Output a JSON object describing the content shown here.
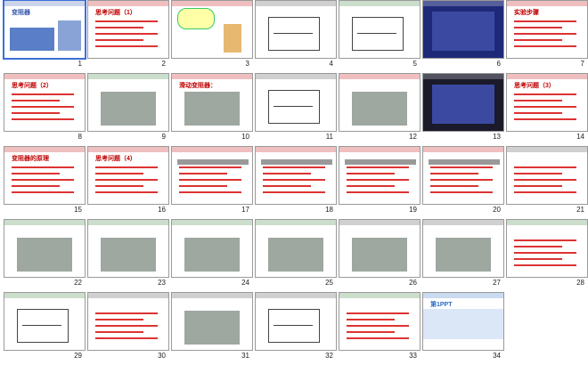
{
  "slides": [
    {
      "num": "1",
      "title": "变阻器",
      "bg": "#ffffff",
      "accent": "#3355aa",
      "kind": "cover"
    },
    {
      "num": "2",
      "title": "思考问题（1）",
      "bg": "#ffffff",
      "accent": "#c00000",
      "kind": "question"
    },
    {
      "num": "3",
      "title": "",
      "bg": "#ffffff",
      "accent": "#c00000",
      "kind": "cartoon"
    },
    {
      "num": "4",
      "title": "",
      "bg": "#ffffff",
      "accent": "#444444",
      "kind": "diagram"
    },
    {
      "num": "5",
      "title": "",
      "bg": "#ffffff",
      "accent": "#2e7d32",
      "kind": "circuit"
    },
    {
      "num": "6",
      "title": "",
      "bg": "#1e2a78",
      "accent": "#ffffff",
      "kind": "photo-dark"
    },
    {
      "num": "7",
      "title": "实验步骤",
      "bg": "#ffffff",
      "accent": "#c00000",
      "kind": "text"
    },
    {
      "num": "8",
      "title": "思考问题（2）",
      "bg": "#ffffff",
      "accent": "#c00000",
      "kind": "question"
    },
    {
      "num": "9",
      "title": "",
      "bg": "#ffffff",
      "accent": "#2e7d32",
      "kind": "photo"
    },
    {
      "num": "10",
      "title": "滑动变阻器：",
      "bg": "#ffffff",
      "accent": "#c00000",
      "kind": "photo"
    },
    {
      "num": "11",
      "title": "",
      "bg": "#ffffff",
      "accent": "#444444",
      "kind": "diagram"
    },
    {
      "num": "12",
      "title": "",
      "bg": "#ffffff",
      "accent": "#c00000",
      "kind": "photo"
    },
    {
      "num": "13",
      "title": "",
      "bg": "#1a1a2a",
      "accent": "#ffffff",
      "kind": "photo-dark"
    },
    {
      "num": "14",
      "title": "思考问题（3）",
      "bg": "#ffffff",
      "accent": "#c00000",
      "kind": "question"
    },
    {
      "num": "15",
      "title": "变阻器的原理",
      "bg": "#ffffff",
      "accent": "#c00000",
      "kind": "text"
    },
    {
      "num": "16",
      "title": "思考问题（4）",
      "bg": "#ffffff",
      "accent": "#c00000",
      "kind": "question"
    },
    {
      "num": "17",
      "title": "",
      "bg": "#ffffff",
      "accent": "#c00000",
      "kind": "quiz"
    },
    {
      "num": "18",
      "title": "",
      "bg": "#ffffff",
      "accent": "#c00000",
      "kind": "quiz"
    },
    {
      "num": "19",
      "title": "",
      "bg": "#ffffff",
      "accent": "#c00000",
      "kind": "quiz"
    },
    {
      "num": "20",
      "title": "",
      "bg": "#ffffff",
      "accent": "#c00000",
      "kind": "quiz"
    },
    {
      "num": "21",
      "title": "",
      "bg": "#ffffff",
      "accent": "#444444",
      "kind": "text"
    },
    {
      "num": "22",
      "title": "",
      "bg": "#ffffff",
      "accent": "#2e7d32",
      "kind": "photo"
    },
    {
      "num": "23",
      "title": "",
      "bg": "#ffffff",
      "accent": "#2e7d32",
      "kind": "photo"
    },
    {
      "num": "24",
      "title": "",
      "bg": "#ffffff",
      "accent": "#2e7d32",
      "kind": "photo"
    },
    {
      "num": "25",
      "title": "",
      "bg": "#ffffff",
      "accent": "#2e7d32",
      "kind": "photo"
    },
    {
      "num": "26",
      "title": "",
      "bg": "#ffffff",
      "accent": "#444444",
      "kind": "photo"
    },
    {
      "num": "27",
      "title": "",
      "bg": "#ffffff",
      "accent": "#444444",
      "kind": "photo"
    },
    {
      "num": "28",
      "title": "",
      "bg": "#ffffff",
      "accent": "#2e7d32",
      "kind": "text"
    },
    {
      "num": "29",
      "title": "",
      "bg": "#ffffff",
      "accent": "#2e7d32",
      "kind": "diagram"
    },
    {
      "num": "30",
      "title": "",
      "bg": "#ffffff",
      "accent": "#444444",
      "kind": "text"
    },
    {
      "num": "31",
      "title": "",
      "bg": "#ffffff",
      "accent": "#444444",
      "kind": "photo"
    },
    {
      "num": "32",
      "title": "",
      "bg": "#ffffff",
      "accent": "#444444",
      "kind": "circuit"
    },
    {
      "num": "33",
      "title": "",
      "bg": "#ffffff",
      "accent": "#2e7d32",
      "kind": "text"
    },
    {
      "num": "34",
      "title": "第1PPT",
      "bg": "#ffffff",
      "accent": "#2b6cc4",
      "kind": "brand"
    }
  ],
  "selected": "1"
}
